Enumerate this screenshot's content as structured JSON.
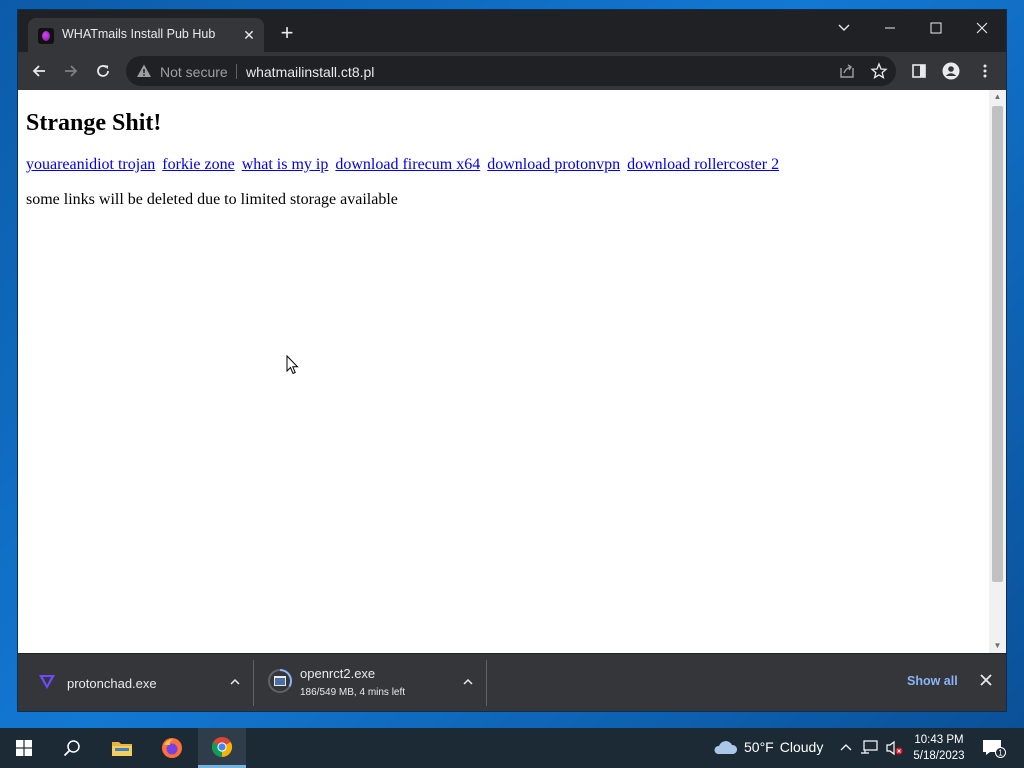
{
  "browser": {
    "tab_title": "WHATmails Install Pub Hub",
    "tab_close": "✕",
    "new_tab": "+",
    "security_label": "Not secure",
    "url": "whatmailinstall.ct8.pl"
  },
  "page": {
    "heading": "Strange Shit!",
    "links": [
      "youareanidiot trojan",
      "forkie zone",
      "what is my ip",
      "download firecum x64",
      "download protonvpn",
      "download rollercoster 2"
    ],
    "note": "some links will be deleted due to limited storage available"
  },
  "downloads": {
    "items": [
      {
        "name": "protonchad.exe",
        "status": ""
      },
      {
        "name": "openrct2.exe",
        "status": "186/549 MB, 4 mins left"
      }
    ],
    "show_all": "Show all"
  },
  "taskbar": {
    "weather_temp": "50°F",
    "weather_desc": "Cloudy",
    "time": "10:43 PM",
    "date": "5/18/2023",
    "notification_count": "1"
  },
  "colors": {
    "link": "#0000ee",
    "chrome_dark": "#202124",
    "chrome_toolbar": "#35363a",
    "show_all": "#8ab4f8"
  }
}
